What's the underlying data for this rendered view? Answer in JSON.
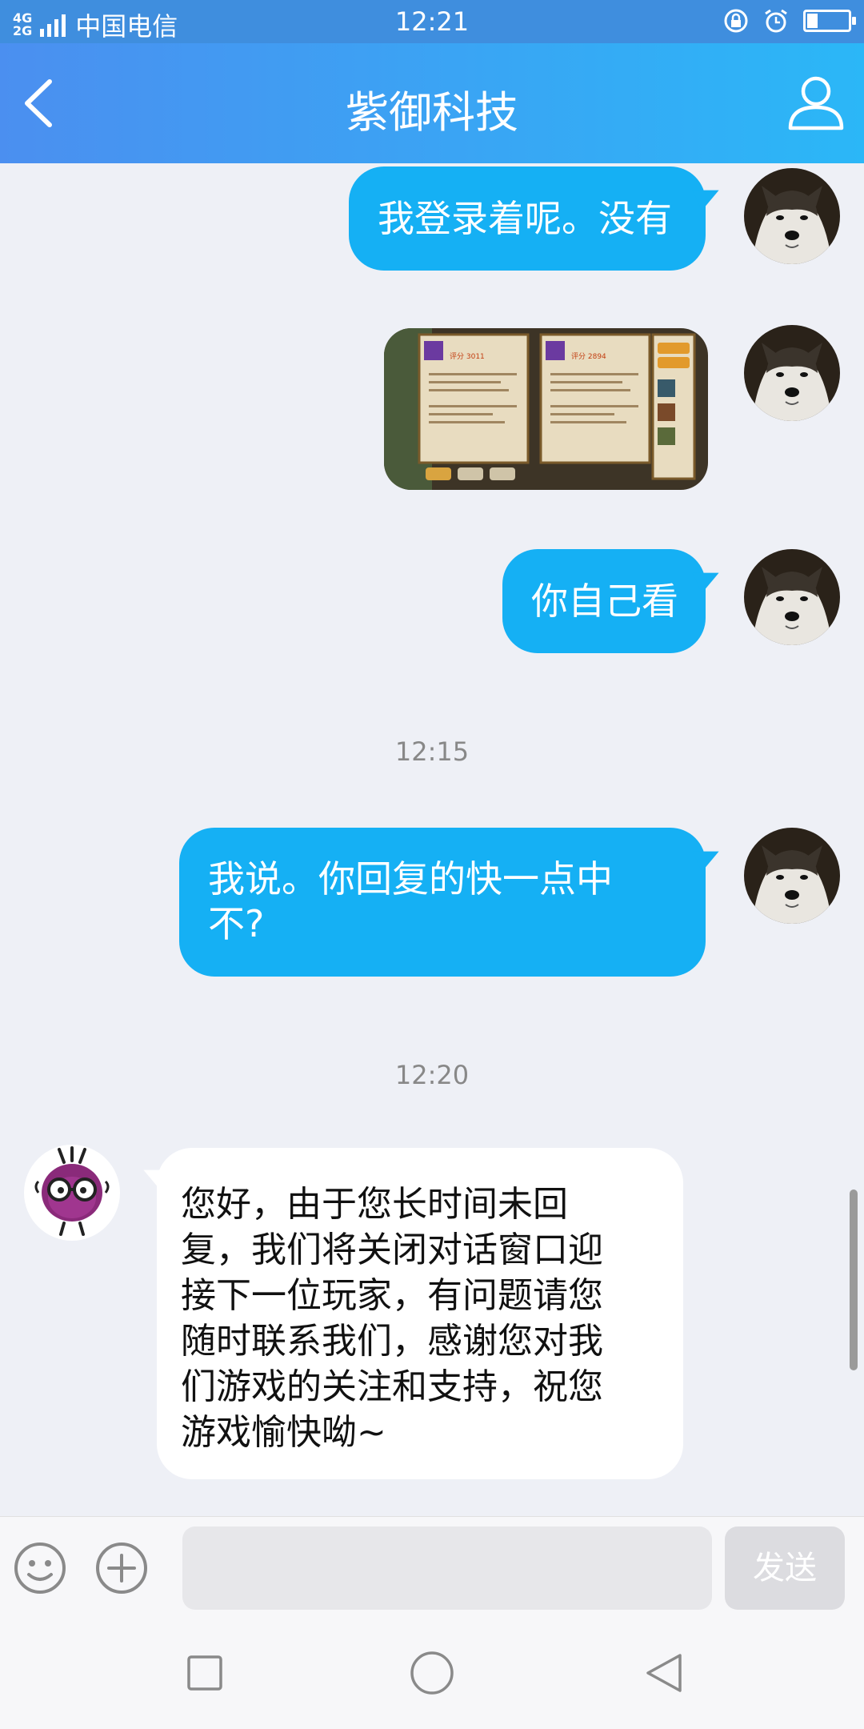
{
  "status_bar": {
    "network_top": "4G",
    "network_bottom": "2G",
    "carrier": "中国电信",
    "time": "12:21",
    "battery_level": 0.25
  },
  "header": {
    "title": "紫御科技",
    "back_icon": "chevron-left-icon",
    "profile_icon": "person-icon"
  },
  "messages": [
    {
      "from": "me",
      "type": "text",
      "text": "我登录着呢。没有"
    },
    {
      "from": "me",
      "type": "image",
      "panel_score_1": "评分 3011",
      "panel_score_2": "评分 2894"
    },
    {
      "from": "me",
      "type": "text",
      "text": "你自己看"
    },
    {
      "type": "timestamp",
      "text": "12:15"
    },
    {
      "from": "me",
      "type": "text",
      "line1": "我说。你回复的快一点中",
      "line2": "不?"
    },
    {
      "type": "timestamp",
      "text": "12:20"
    },
    {
      "from": "service",
      "type": "text",
      "lines": [
        "您好，由于您长时间未回",
        "复，我们将关闭对话窗口迎",
        "接下一位玩家，有问题请您",
        "随时联系我们，感谢您对我",
        "们游戏的关注和支持，祝您",
        "游戏愉快呦~"
      ]
    }
  ],
  "input_bar": {
    "placeholder": "",
    "send_label": "发送",
    "emoji_icon": "smiley-icon",
    "plus_icon": "plus-circle-icon"
  },
  "nav_bar": {
    "icons": [
      "square-icon",
      "circle-icon",
      "triangle-back-icon"
    ]
  }
}
